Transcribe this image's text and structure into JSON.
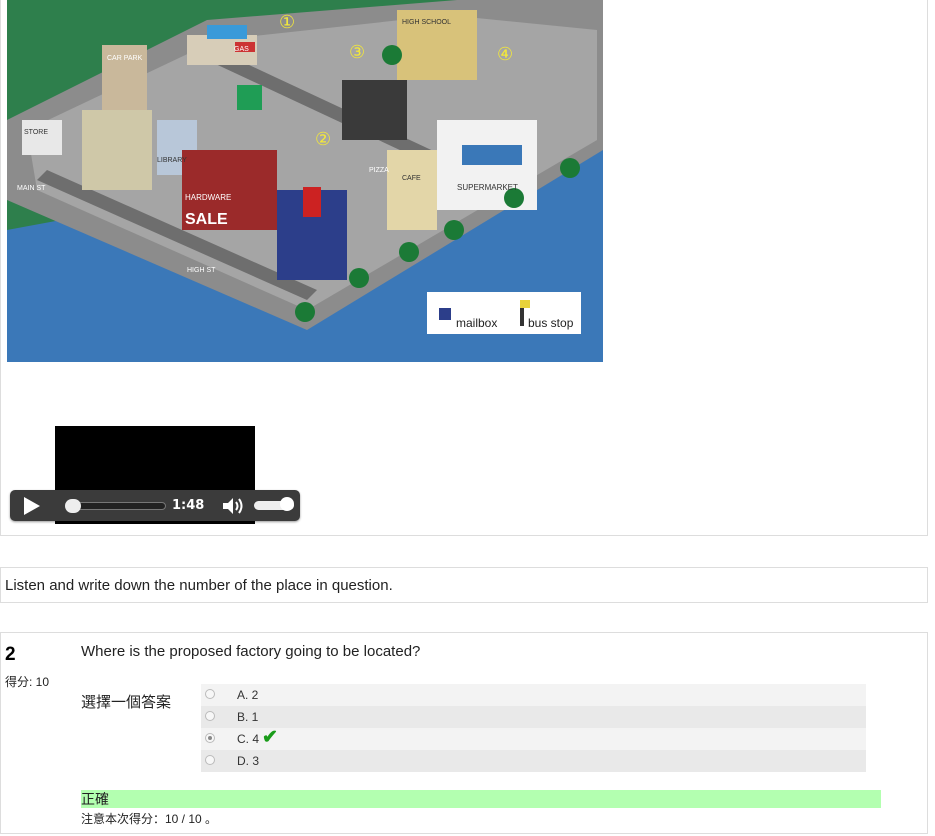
{
  "map": {
    "markers": [
      "①",
      "②",
      "③",
      "④"
    ],
    "signs": {
      "car_park": "CAR PARK",
      "gas": "GAS",
      "high_school": "HIGH SCHOOL",
      "store": "STORE",
      "library": "LIBRARY",
      "hardware": "HARDWARE",
      "sale": "SALE",
      "main_st": "MAIN ST",
      "high_st": "HIGH ST",
      "supermarket": "SUPERMARKET",
      "cafe": "CAFE",
      "pizza": "PIZZA"
    },
    "legend": {
      "mailbox": "mailbox",
      "bus_stop": "bus stop"
    }
  },
  "player": {
    "time": "1:48",
    "progress": 0.05
  },
  "instruction": "Listen and write down the number of the place in question.",
  "question": {
    "number": "2",
    "score_label": "得分: 10",
    "text": "Where is the proposed factory going to be located?",
    "prompt": "選擇一個答案",
    "options": [
      {
        "label": "A. 2",
        "selected": false
      },
      {
        "label": "B. 1",
        "selected": false
      },
      {
        "label": "C. 4",
        "selected": true,
        "correct": true
      },
      {
        "label": "D. 3",
        "selected": false
      }
    ],
    "feedback": "正確",
    "score_note": "注意本次得分：10 / 10 。"
  },
  "colors": {
    "correct_bg": "#b3ffb0",
    "check": "#1a9c1a"
  }
}
